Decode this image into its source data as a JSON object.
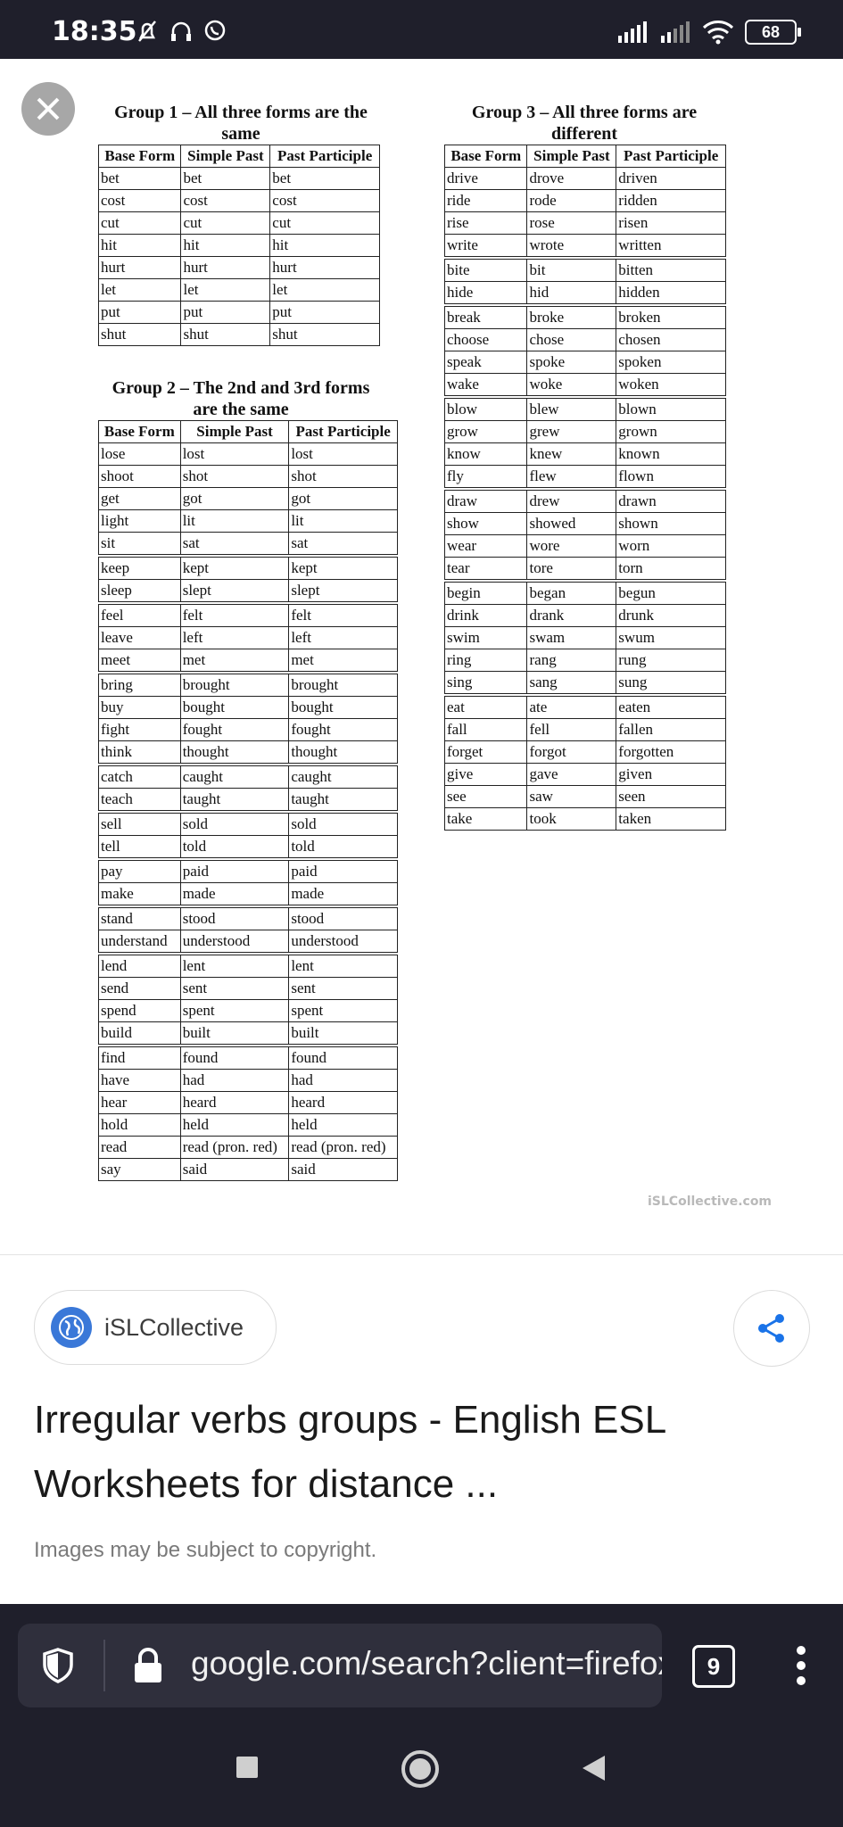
{
  "status_bar": {
    "time": "18:35",
    "battery": "68"
  },
  "worksheet": {
    "group1": {
      "title_line1": "Group 1 – All three forms are the",
      "title_line2": "same",
      "headers": [
        "Base Form",
        "Simple Past",
        "Past Participle"
      ],
      "rows": [
        [
          "bet",
          "bet",
          "bet"
        ],
        [
          "cost",
          "cost",
          "cost"
        ],
        [
          "cut",
          "cut",
          "cut"
        ],
        [
          "hit",
          "hit",
          "hit"
        ],
        [
          "hurt",
          "hurt",
          "hurt"
        ],
        [
          "let",
          "let",
          "let"
        ],
        [
          "put",
          "put",
          "put"
        ],
        [
          "shut",
          "shut",
          "shut"
        ]
      ]
    },
    "group2": {
      "title_line1": "Group 2 – The 2nd and 3rd forms",
      "title_line2": "are the same",
      "headers": [
        "Base Form",
        "Simple Past",
        "Past Participle"
      ],
      "rows": [
        [
          "lose",
          "lost",
          "lost"
        ],
        [
          "shoot",
          "shot",
          "shot"
        ],
        [
          "get",
          "got",
          "got"
        ],
        [
          "light",
          "lit",
          "lit"
        ],
        [
          "sit",
          "sat",
          "sat"
        ],
        [
          "keep",
          "kept",
          "kept"
        ],
        [
          "sleep",
          "slept",
          "slept"
        ],
        [
          "feel",
          "felt",
          "felt"
        ],
        [
          "leave",
          "left",
          "left"
        ],
        [
          "meet",
          "met",
          "met"
        ],
        [
          "bring",
          "brought",
          "brought"
        ],
        [
          "buy",
          "bought",
          "bought"
        ],
        [
          "fight",
          "fought",
          "fought"
        ],
        [
          "think",
          "thought",
          "thought"
        ],
        [
          "catch",
          "caught",
          "caught"
        ],
        [
          "teach",
          "taught",
          "taught"
        ],
        [
          "sell",
          "sold",
          "sold"
        ],
        [
          "tell",
          "told",
          "told"
        ],
        [
          "pay",
          "paid",
          "paid"
        ],
        [
          "make",
          "made",
          "made"
        ],
        [
          "stand",
          "stood",
          "stood"
        ],
        [
          "understand",
          "understood",
          "understood"
        ],
        [
          "lend",
          "lent",
          "lent"
        ],
        [
          "send",
          "sent",
          "sent"
        ],
        [
          "spend",
          "spent",
          "spent"
        ],
        [
          "build",
          "built",
          "built"
        ],
        [
          "find",
          "found",
          "found"
        ],
        [
          "have",
          "had",
          "had"
        ],
        [
          "hear",
          "heard",
          "heard"
        ],
        [
          "hold",
          "held",
          "held"
        ],
        [
          "read",
          "read (pron. red)",
          "read (pron. red)"
        ],
        [
          "say",
          "said",
          "said"
        ]
      ],
      "separators_before": [
        5,
        7,
        10,
        14,
        16,
        18,
        20,
        22,
        26
      ]
    },
    "group3": {
      "title_line1": "Group 3 – All three forms are",
      "title_line2": "different",
      "headers": [
        "Base Form",
        "Simple Past",
        "Past Participle"
      ],
      "rows": [
        [
          "drive",
          "drove",
          "driven"
        ],
        [
          "ride",
          "rode",
          "ridden"
        ],
        [
          "rise",
          "rose",
          "risen"
        ],
        [
          "write",
          "wrote",
          "written"
        ],
        [
          "bite",
          "bit",
          "bitten"
        ],
        [
          "hide",
          "hid",
          "hidden"
        ],
        [
          "break",
          "broke",
          "broken"
        ],
        [
          "choose",
          "chose",
          "chosen"
        ],
        [
          "speak",
          "spoke",
          "spoken"
        ],
        [
          "wake",
          "woke",
          "woken"
        ],
        [
          "blow",
          "blew",
          "blown"
        ],
        [
          "grow",
          "grew",
          "grown"
        ],
        [
          "know",
          "knew",
          "known"
        ],
        [
          "fly",
          "flew",
          "flown"
        ],
        [
          "draw",
          "drew",
          "drawn"
        ],
        [
          "show",
          "showed",
          "shown"
        ],
        [
          "wear",
          "wore",
          "worn"
        ],
        [
          "tear",
          "tore",
          "torn"
        ],
        [
          "begin",
          "began",
          "begun"
        ],
        [
          "drink",
          "drank",
          "drunk"
        ],
        [
          "swim",
          "swam",
          "swum"
        ],
        [
          "ring",
          "rang",
          "rung"
        ],
        [
          "sing",
          "sang",
          "sung"
        ],
        [
          "eat",
          "ate",
          "eaten"
        ],
        [
          "fall",
          "fell",
          "fallen"
        ],
        [
          "forget",
          "forgot",
          "forgotten"
        ],
        [
          "give",
          "gave",
          "given"
        ],
        [
          "see",
          "saw",
          "seen"
        ],
        [
          "take",
          "took",
          "taken"
        ]
      ],
      "separators_before": [
        4,
        6,
        10,
        14,
        18,
        23
      ]
    },
    "watermark": "iSLCollective.com"
  },
  "result": {
    "source_name": "iSLCollective",
    "title": "Irregular verbs groups - English ESL Worksheets for distance ...",
    "copyright": "Images may be subject to copyright."
  },
  "browser": {
    "url": "google.com/search?client=firefox-b-m",
    "tab_count": "9"
  },
  "icons": [
    "close-icon",
    "globe-icon",
    "share-icon",
    "shield-icon",
    "lock-icon",
    "menu-icon",
    "home-icon",
    "back-icon",
    "recents-icon"
  ]
}
